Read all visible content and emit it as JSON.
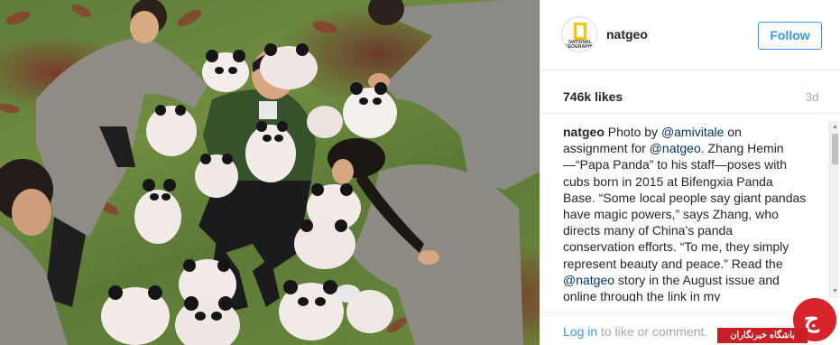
{
  "post": {
    "photo_alt_icon": "panda-photo",
    "username": "natgeo",
    "avatar_text": "NATIONAL GEOGRAPHIC",
    "follow_label": "Follow",
    "likes": "746k likes",
    "time_ago": "3d",
    "caption": {
      "author": "natgeo",
      "segments": [
        {
          "text": " Photo by ",
          "mention": false
        },
        {
          "text": "@amivitale",
          "mention": true
        },
        {
          "text": " on assignment for ",
          "mention": false
        },
        {
          "text": "@natgeo",
          "mention": true
        },
        {
          "text": ". Zhang Hemin —“Papa Panda” to his staff—poses with cubs born in 2015 at Bifengxia Panda Base. “Some local people say giant pandas have magic powers,” says Zhang, who directs many of China’s panda conservation efforts. “To me, they simply represent beauty and peace.” Read the ",
          "mention": false
        },
        {
          "text": "@natgeo",
          "mention": true
        },
        {
          "text": " story in the August issue and online through the link in my",
          "mention": false
        }
      ]
    },
    "login_link": "Log in",
    "login_rest": " to like or comment."
  },
  "watermark": {
    "glyph": "ج",
    "text": "باشگاه خبرنگاران"
  },
  "colors": {
    "accent": "#3897f0",
    "mention": "#003569",
    "muted": "#a5a7aa",
    "watermark_red": "#d7242a"
  }
}
